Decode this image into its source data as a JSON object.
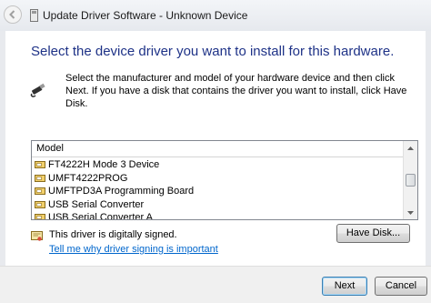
{
  "window": {
    "title": "Update Driver Software - Unknown Device"
  },
  "main": {
    "heading": "Select the device driver you want to install for this hardware.",
    "instructions": "Select the manufacturer and model of your hardware device and then click Next. If you have a disk that contains the driver you want to install, click Have Disk.",
    "device_icon": "usb-cable-icon"
  },
  "driver_list": {
    "column_header": "Model",
    "items": [
      "FT4222H Mode 3 Device",
      "UMFT4222PROG",
      "UMFTPD3A Programming Board",
      "USB Serial Converter",
      "USB Serial Converter A"
    ],
    "item_icon": "device-driver-icon"
  },
  "signing": {
    "status_text": "This driver is digitally signed.",
    "status_icon": "certificate-icon",
    "link_text": "Tell me why driver signing is important"
  },
  "buttons": {
    "have_disk": "Have Disk...",
    "next": "Next",
    "cancel": "Cancel"
  },
  "colors": {
    "heading": "#1e3287",
    "link": "#0066cc"
  }
}
